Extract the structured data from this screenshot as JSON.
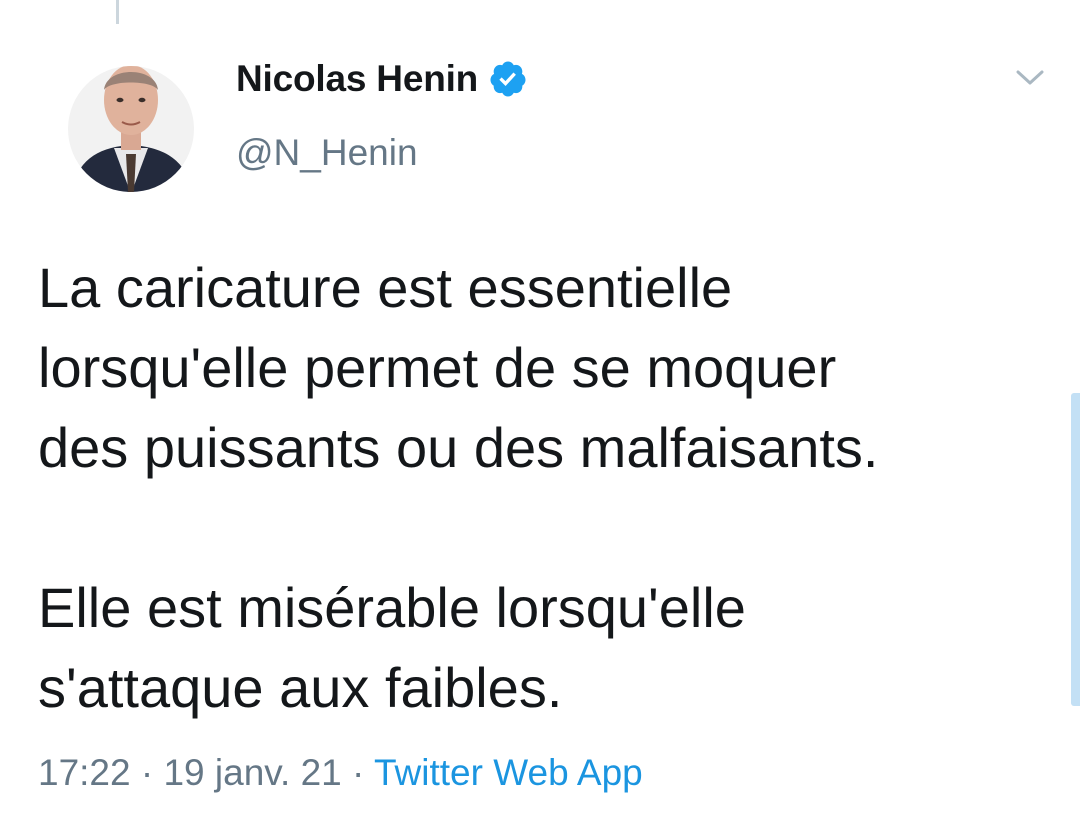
{
  "author": {
    "name": "Nicolas Henin",
    "handle": "@N_Henin",
    "verified": true,
    "verified_icon": "verified-badge-icon"
  },
  "tweet": {
    "paragraphs": [
      "La caricature est essentielle\nlorsqu'elle permet de se moquer\ndes puissants ou des malfaisants.",
      "Elle est misérable lorsqu'elle\ns'attaque aux faibles."
    ]
  },
  "meta": {
    "time": "17:22",
    "separator": "·",
    "date": "19 janv. 21",
    "source": "Twitter Web App"
  },
  "icons": {
    "menu": "chevron-down-icon"
  },
  "colors": {
    "text_primary": "#14171a",
    "text_secondary": "#657786",
    "link": "#1b95e0",
    "verified": "#1da1f2"
  }
}
